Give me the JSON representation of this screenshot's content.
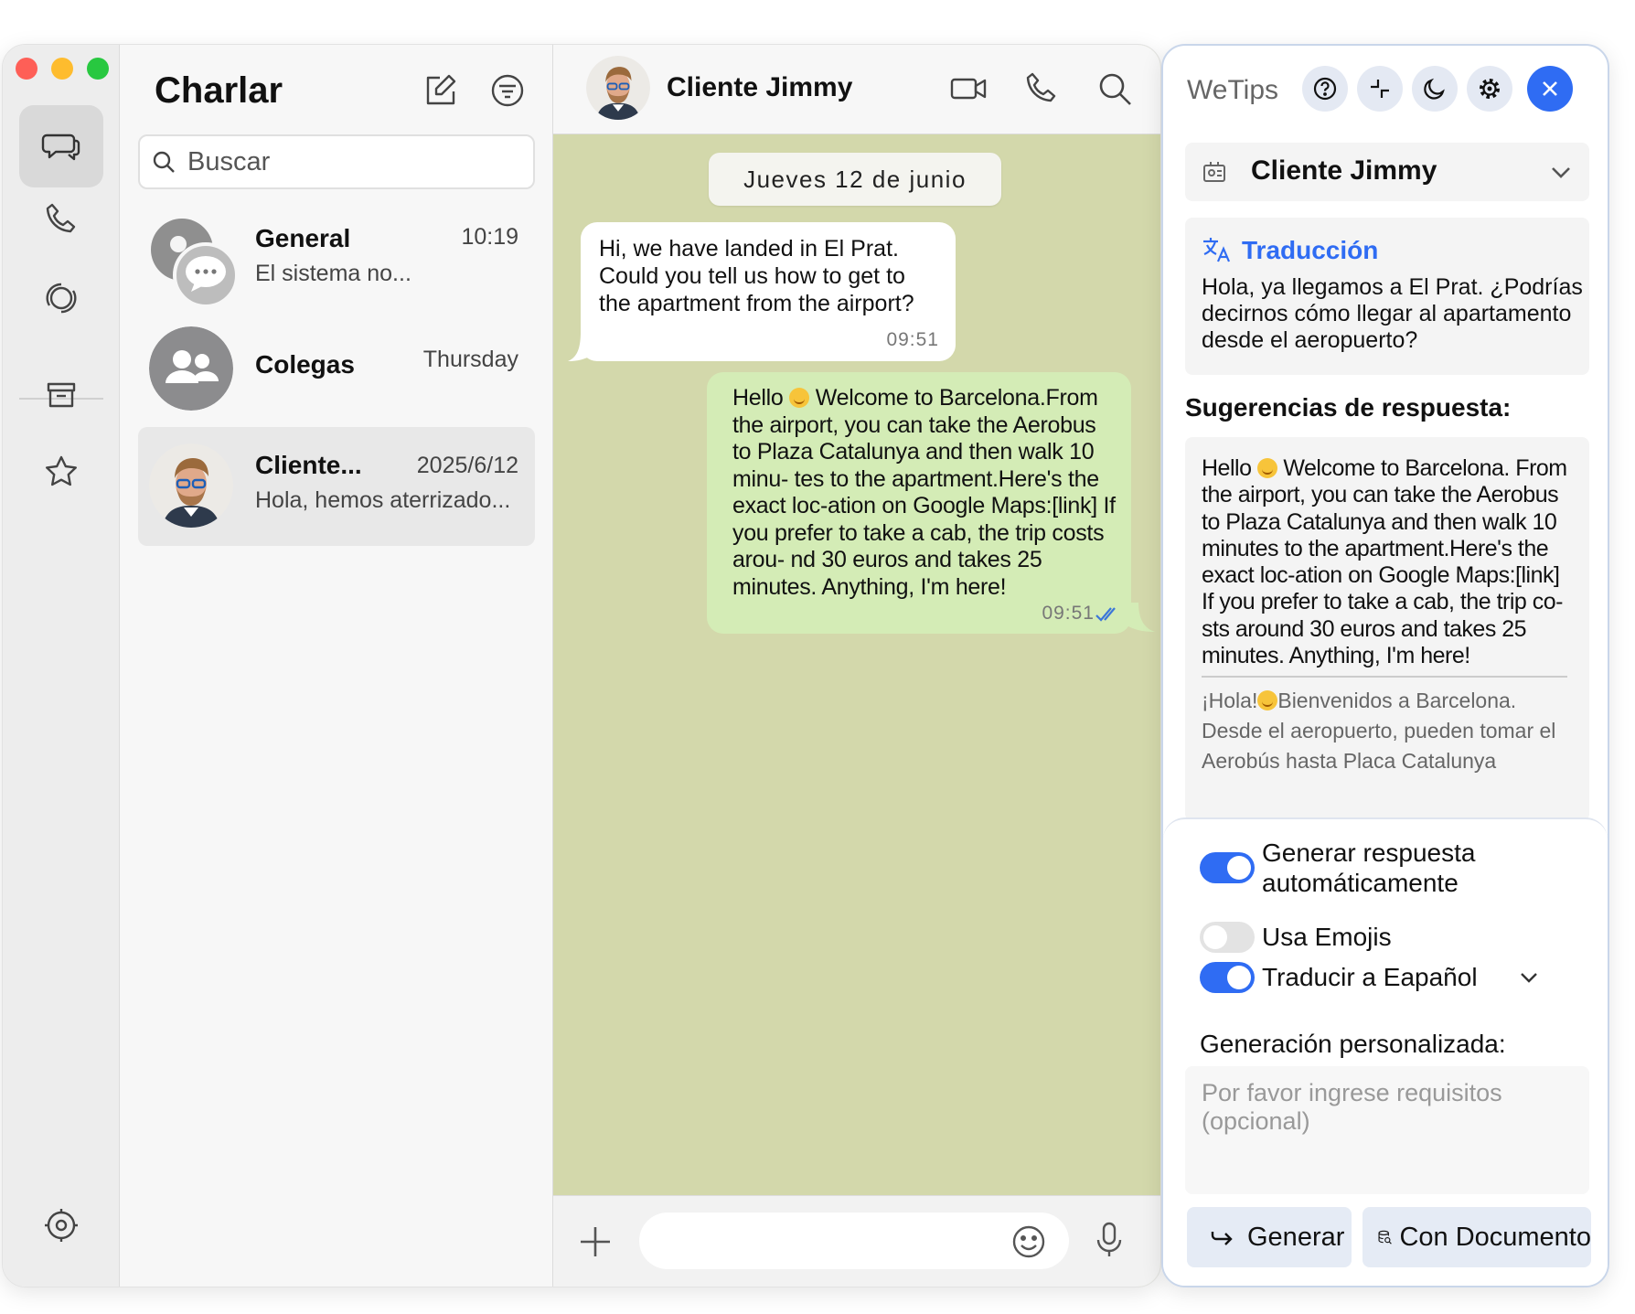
{
  "chatlist": {
    "title": "Charlar",
    "search_placeholder": "Buscar",
    "chats": [
      {
        "name": "General",
        "time": "10:19",
        "preview": "El sistema no..."
      },
      {
        "name": "Colegas",
        "time": "Thursday",
        "preview": ""
      },
      {
        "name": "Cliente...",
        "time": "2025/6/12",
        "preview": "Hola, hemos aterrizado..."
      }
    ]
  },
  "conversation": {
    "contact_name": "Cliente Jimmy",
    "date_label": "Jueves 12 de junio",
    "messages": [
      {
        "direction": "in",
        "text": "Hi, we have landed in El Prat. Could you tell us how to get to the apartment from the airport?",
        "time": "09:51"
      },
      {
        "direction": "out",
        "text_before_emoji": "Hello ",
        "emoji": "smiling-face-emoji",
        "text_after_emoji": " Welcome to Barcelona.From the airport, you can take the Aerobus to Plaza Catalunya and then walk 10 minu- tes to the apartment.Here's the exact loc-ation on Google Maps:[link] If you prefer to take a cab, the trip costs arou- nd 30 euros and takes 25 minutes. Anything, I'm here!",
        "time": "09:51",
        "status": "read"
      }
    ],
    "composer_placeholder": ""
  },
  "wetips": {
    "title": "WeTips",
    "contact": "Cliente Jimmy",
    "translation_title": "Traducción",
    "translation_text": "Hola, ya llegamos a El Prat. ¿Podrías decirnos cómo llegar al apartamento desde el aeropuerto?",
    "suggestions_title": "Sugerencias de respuesta:",
    "suggestion_en_before": "Hello ",
    "suggestion_en_after": " Welcome to Barcelona. From the airport, you can take the Aerobus to Plaza Catalunya and then walk 10 minutes to the apartment.Here's the exact loc-ation on Google Maps:[link] If you prefer to take a cab, the trip co-sts around 30 euros and takes 25 minutes. Anything, I'm here!",
    "suggestion_es_before": "¡Hola!",
    "suggestion_es_after": "Bienvenidos a Barcelona. Desde el aeropuerto, pueden tomar el Aerobús hasta Placa Catalunya",
    "settings": {
      "auto_reply_label": "Generar respuesta automáticamente",
      "auto_reply_on": true,
      "emojis_label": "Usa Emojis",
      "emojis_on": false,
      "translate_label": "Traducir a Eapañol",
      "translate_on": true
    },
    "custom_title": "Generación personalizada:",
    "custom_placeholder": "Por favor ingrese requisitos (opcional)",
    "generate_label": "Generar",
    "with_doc_label": "Con Documento"
  },
  "colors": {
    "accent_blue": "#2f6cf3",
    "chat_background": "#d3d8ab",
    "outgoing_bubble": "#d4ecb6",
    "incoming_bubble": "#ffffff"
  }
}
